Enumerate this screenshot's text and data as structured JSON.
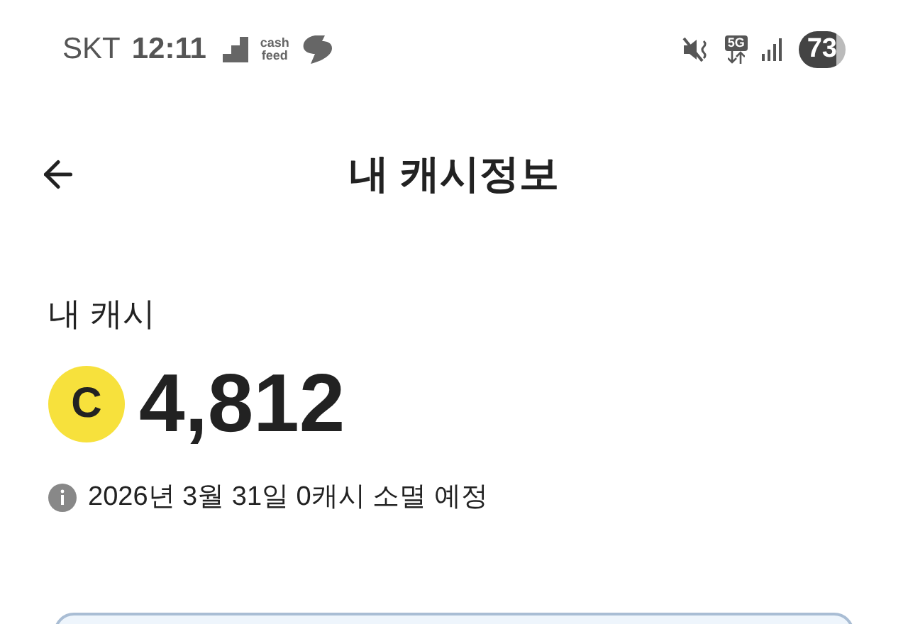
{
  "status_bar": {
    "carrier": "SKT",
    "time": "12:11",
    "app_label": [
      "cash",
      "feed"
    ],
    "battery": "73",
    "network": "5G"
  },
  "header": {
    "title": "내 캐시정보"
  },
  "cash": {
    "label": "내 캐시",
    "coin": "C",
    "amount": "4,812",
    "notice": "2026년 3월 31일 0캐시 소멸 예정"
  }
}
